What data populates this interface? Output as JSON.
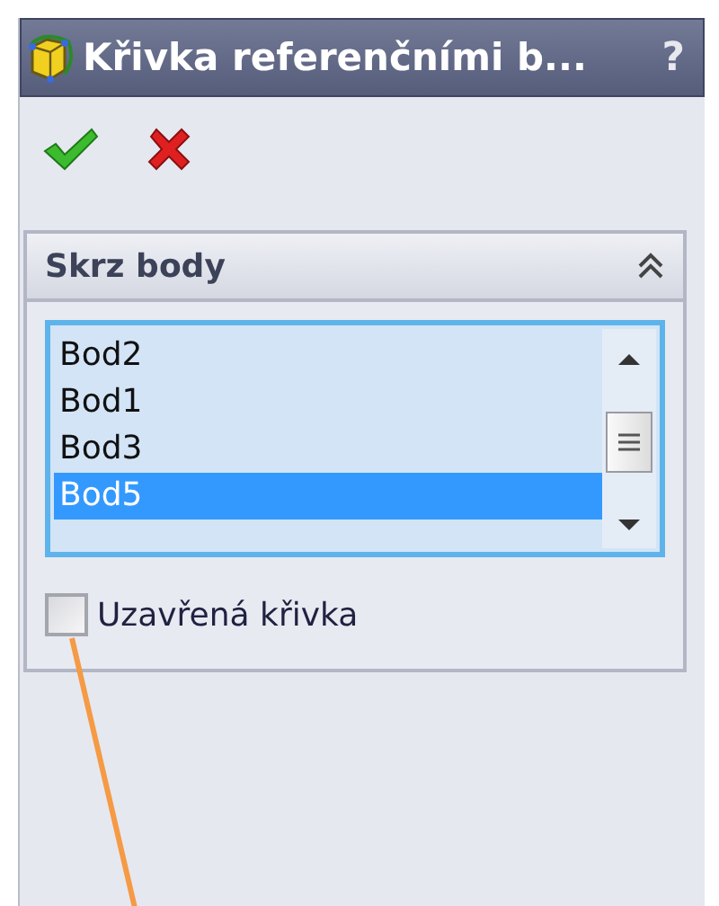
{
  "window": {
    "title": "Křivka referenčními b...",
    "help": "?"
  },
  "panel": {
    "title": "Skrz body",
    "expanded": true,
    "items": [
      {
        "label": "Bod2",
        "selected": false
      },
      {
        "label": "Bod1",
        "selected": false
      },
      {
        "label": "Bod3",
        "selected": false
      },
      {
        "label": "Bod5",
        "selected": true
      }
    ],
    "closed_curve": {
      "label": "Uzavřená křivka",
      "checked": false
    }
  }
}
